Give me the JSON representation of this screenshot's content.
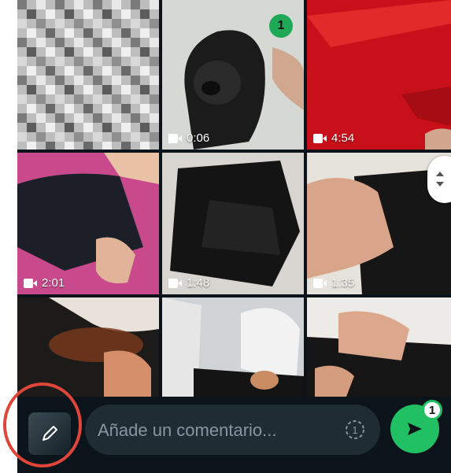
{
  "gallery": {
    "tiles": [
      {
        "duration": ""
      },
      {
        "duration": "0:06",
        "selected_badge": "1"
      },
      {
        "duration": "4:54"
      },
      {
        "duration": "2:01"
      },
      {
        "duration": "1:48"
      },
      {
        "duration": "1:35"
      },
      {
        "duration": ""
      },
      {
        "duration": ""
      },
      {
        "duration": ""
      }
    ]
  },
  "composer": {
    "placeholder": "Añade un comentario...",
    "timer_icon": "view-once-icon",
    "send_count": "1",
    "edit_icon": "pencil-icon",
    "send_icon": "send-icon"
  },
  "colors": {
    "accent": "#21c063",
    "annotation": "#e0453a"
  }
}
